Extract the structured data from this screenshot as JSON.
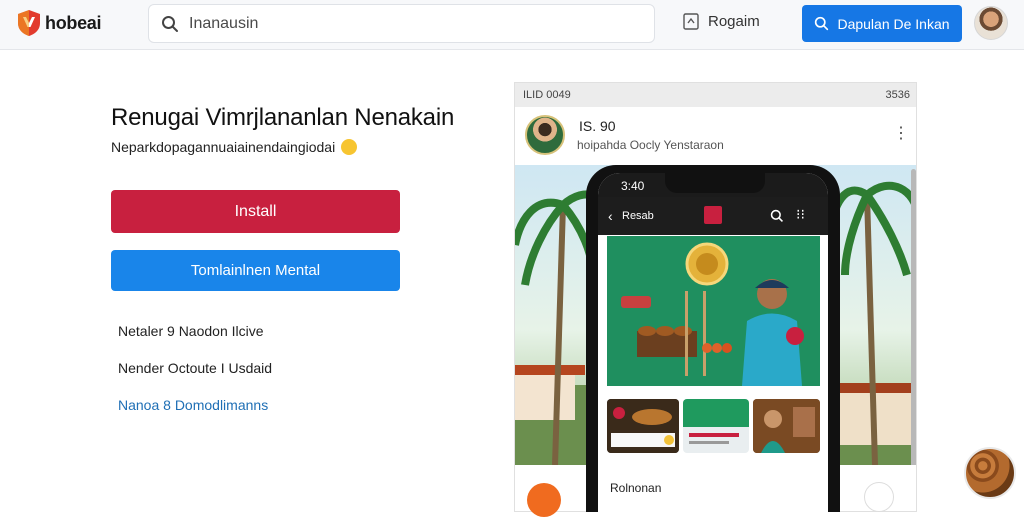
{
  "header": {
    "logo_text": "hobeai",
    "search_placeholder": "Inanausin",
    "program_label": "Rogaim",
    "cta_label": "Dapulan De Inkan"
  },
  "hero": {
    "headline": "Renugai Vimrjlananlan Nenakain",
    "subline": "Neparkdopagannuaiainendaingiodai",
    "install_label": "Install",
    "secondary_label": "Tomlainlnen Mental"
  },
  "info_lines": [
    "Netaler 9 Naodon Ilcive",
    "Nender Octoute I Usdaid",
    "Nanoa 8 Domodlimanns"
  ],
  "preview": {
    "status_left": "ILID 0049",
    "status_right": "3536",
    "post_title": "IS. 90",
    "post_subtitle": "hoipahda Oocly Yenstaraon",
    "phone_time": "3:40",
    "phone_nav_label": "Resab",
    "phone_footer": "Rolnonan"
  },
  "colors": {
    "install": "#c8203f",
    "primary": "#1677e5",
    "link": "#1f6fb5"
  }
}
